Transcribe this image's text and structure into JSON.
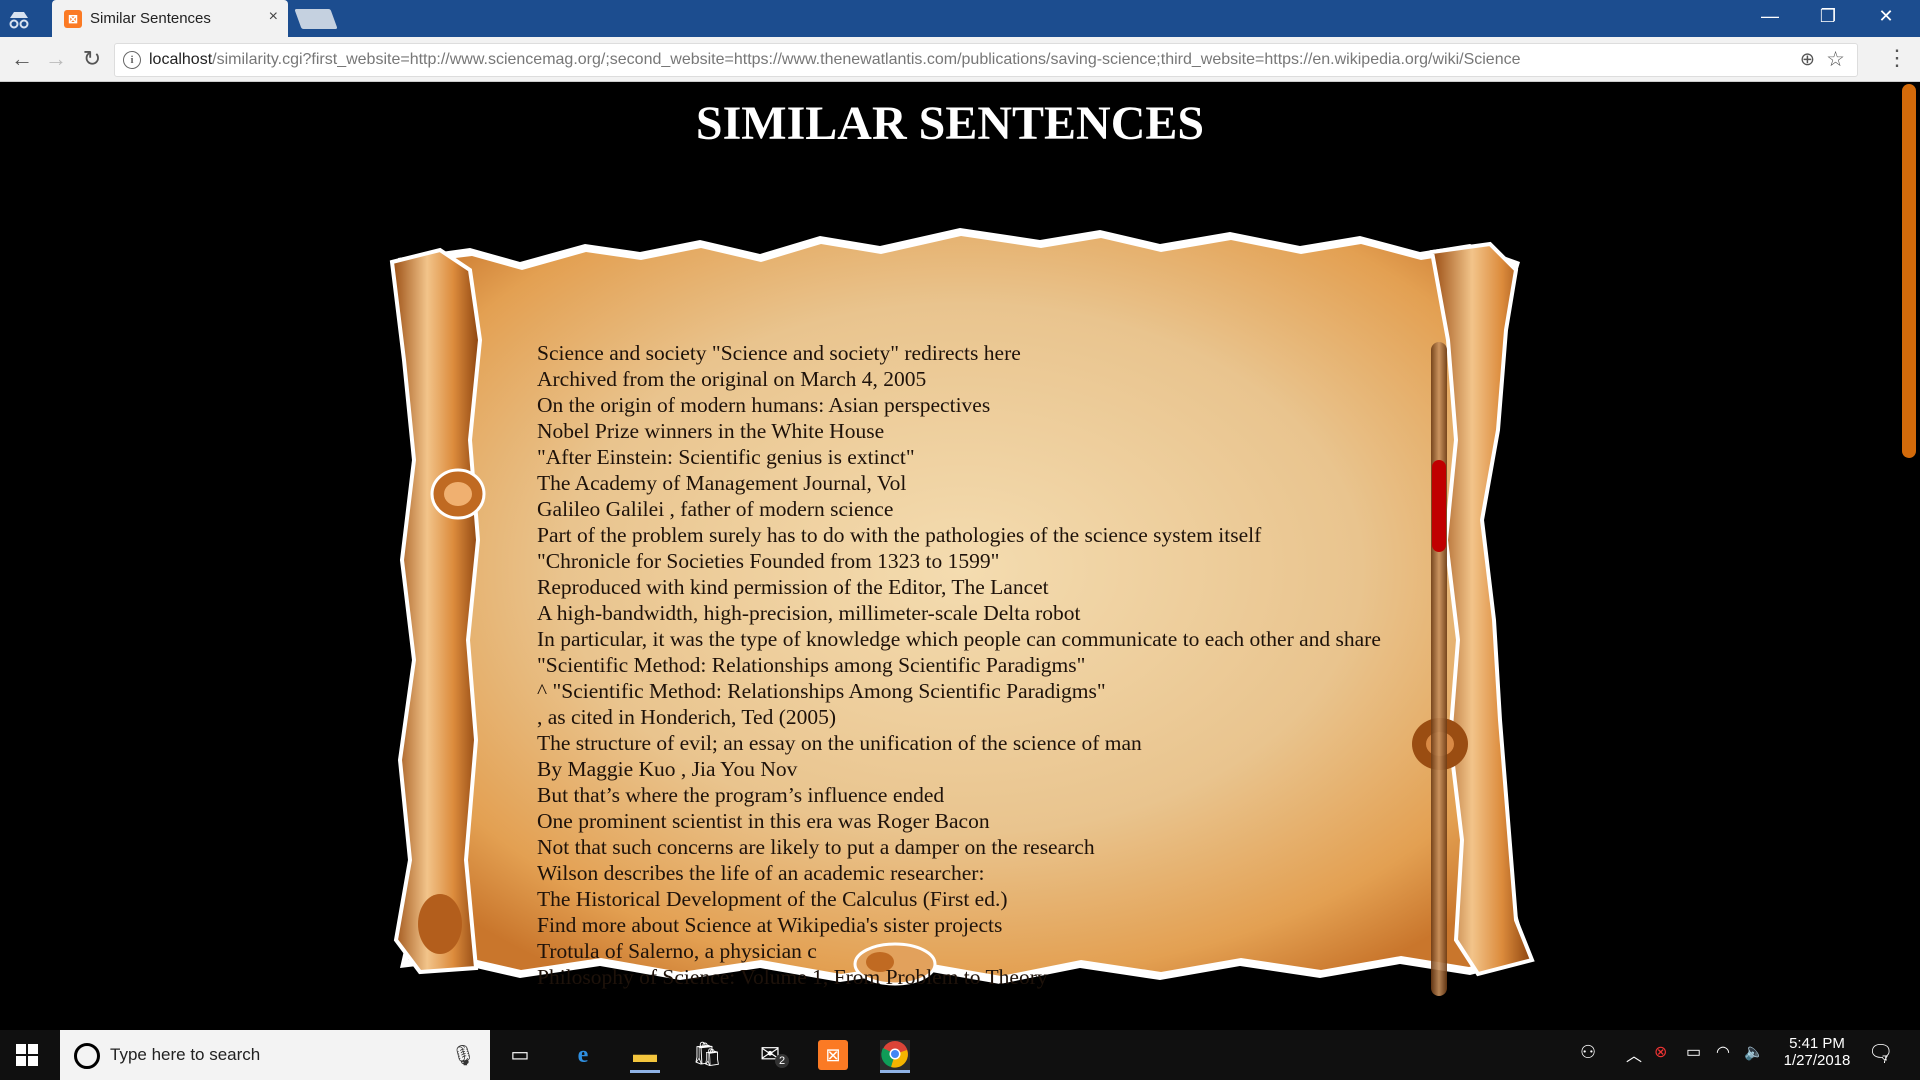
{
  "browser": {
    "tab_title": "Similar Sentences",
    "tab_close": "×",
    "url_host": "localhost",
    "url_rest": "/similarity.cgi?first_website=http://www.sciencemag.org/;second_website=https://www.thenewatlantis.com/publications/saving-science;third_website=https://en.wikipedia.org/wiki/Science",
    "icons": [
      "incognito-icon",
      "back-icon",
      "forward-icon",
      "reload-icon",
      "info-icon",
      "zoom-icon",
      "star-icon",
      "menu-icon"
    ]
  },
  "page": {
    "title": "SIMILAR SENTENCES",
    "sentences": [
      "Science and society \"Science and society\" redirects here",
      "Archived from the original on March 4, 2005",
      "On the origin of modern humans: Asian perspectives",
      "Nobel Prize winners in the White House",
      "\"After Einstein: Scientific genius is extinct\"",
      "The Academy of Management Journal, Vol",
      "Galileo Galilei , father of modern science",
      "Part of the problem surely has to do with the pathologies of the science system itself",
      "\"Chronicle for Societies Founded from 1323 to 1599\"",
      "Reproduced with kind permission of the Editor, The Lancet",
      "A high-bandwidth, high-precision, millimeter-scale Delta robot",
      "In particular, it was the type of knowledge which people can communicate to each other and share",
      "\"Scientific Method: Relationships among Scientific Paradigms\"",
      "^ \"Scientific Method: Relationships Among Scientific Paradigms\"",
      ", as cited in Honderich, Ted (2005)",
      "The structure of evil; an essay on the unification of the science of man",
      "By Maggie Kuo , Jia You Nov",
      "But that’s where the program’s influence ended",
      "One prominent scientist in this era was Roger Bacon",
      "Not that such concerns are likely to put a damper on the research",
      "Wilson describes the life of an academic researcher:",
      "The Historical Development of the Calculus (First ed.)",
      "Find more about Science at Wikipedia's sister projects",
      "Trotula of Salerno, a physician c",
      "Philosophy of Science: Volume 1, From Problem to Theory"
    ],
    "colors": {
      "background": "#000000",
      "title": "#ffffff",
      "parchment": "#e9c48e",
      "scroll_thumb": "#c00000",
      "page_scrollbar": "#d36a0a"
    }
  },
  "taskbar": {
    "search_placeholder": "Type here to search",
    "time": "5:41 PM",
    "date": "1/27/2018",
    "mail_badge": "2",
    "notification_count": "7",
    "icons": [
      "windows-start-icon",
      "task-view-icon",
      "edge-icon",
      "file-explorer-icon",
      "store-icon",
      "mail-icon",
      "xampp-icon",
      "chrome-icon",
      "people-icon",
      "chevron-up-icon",
      "security-icon",
      "battery-icon",
      "wifi-icon",
      "volume-icon",
      "action-center-icon"
    ]
  }
}
